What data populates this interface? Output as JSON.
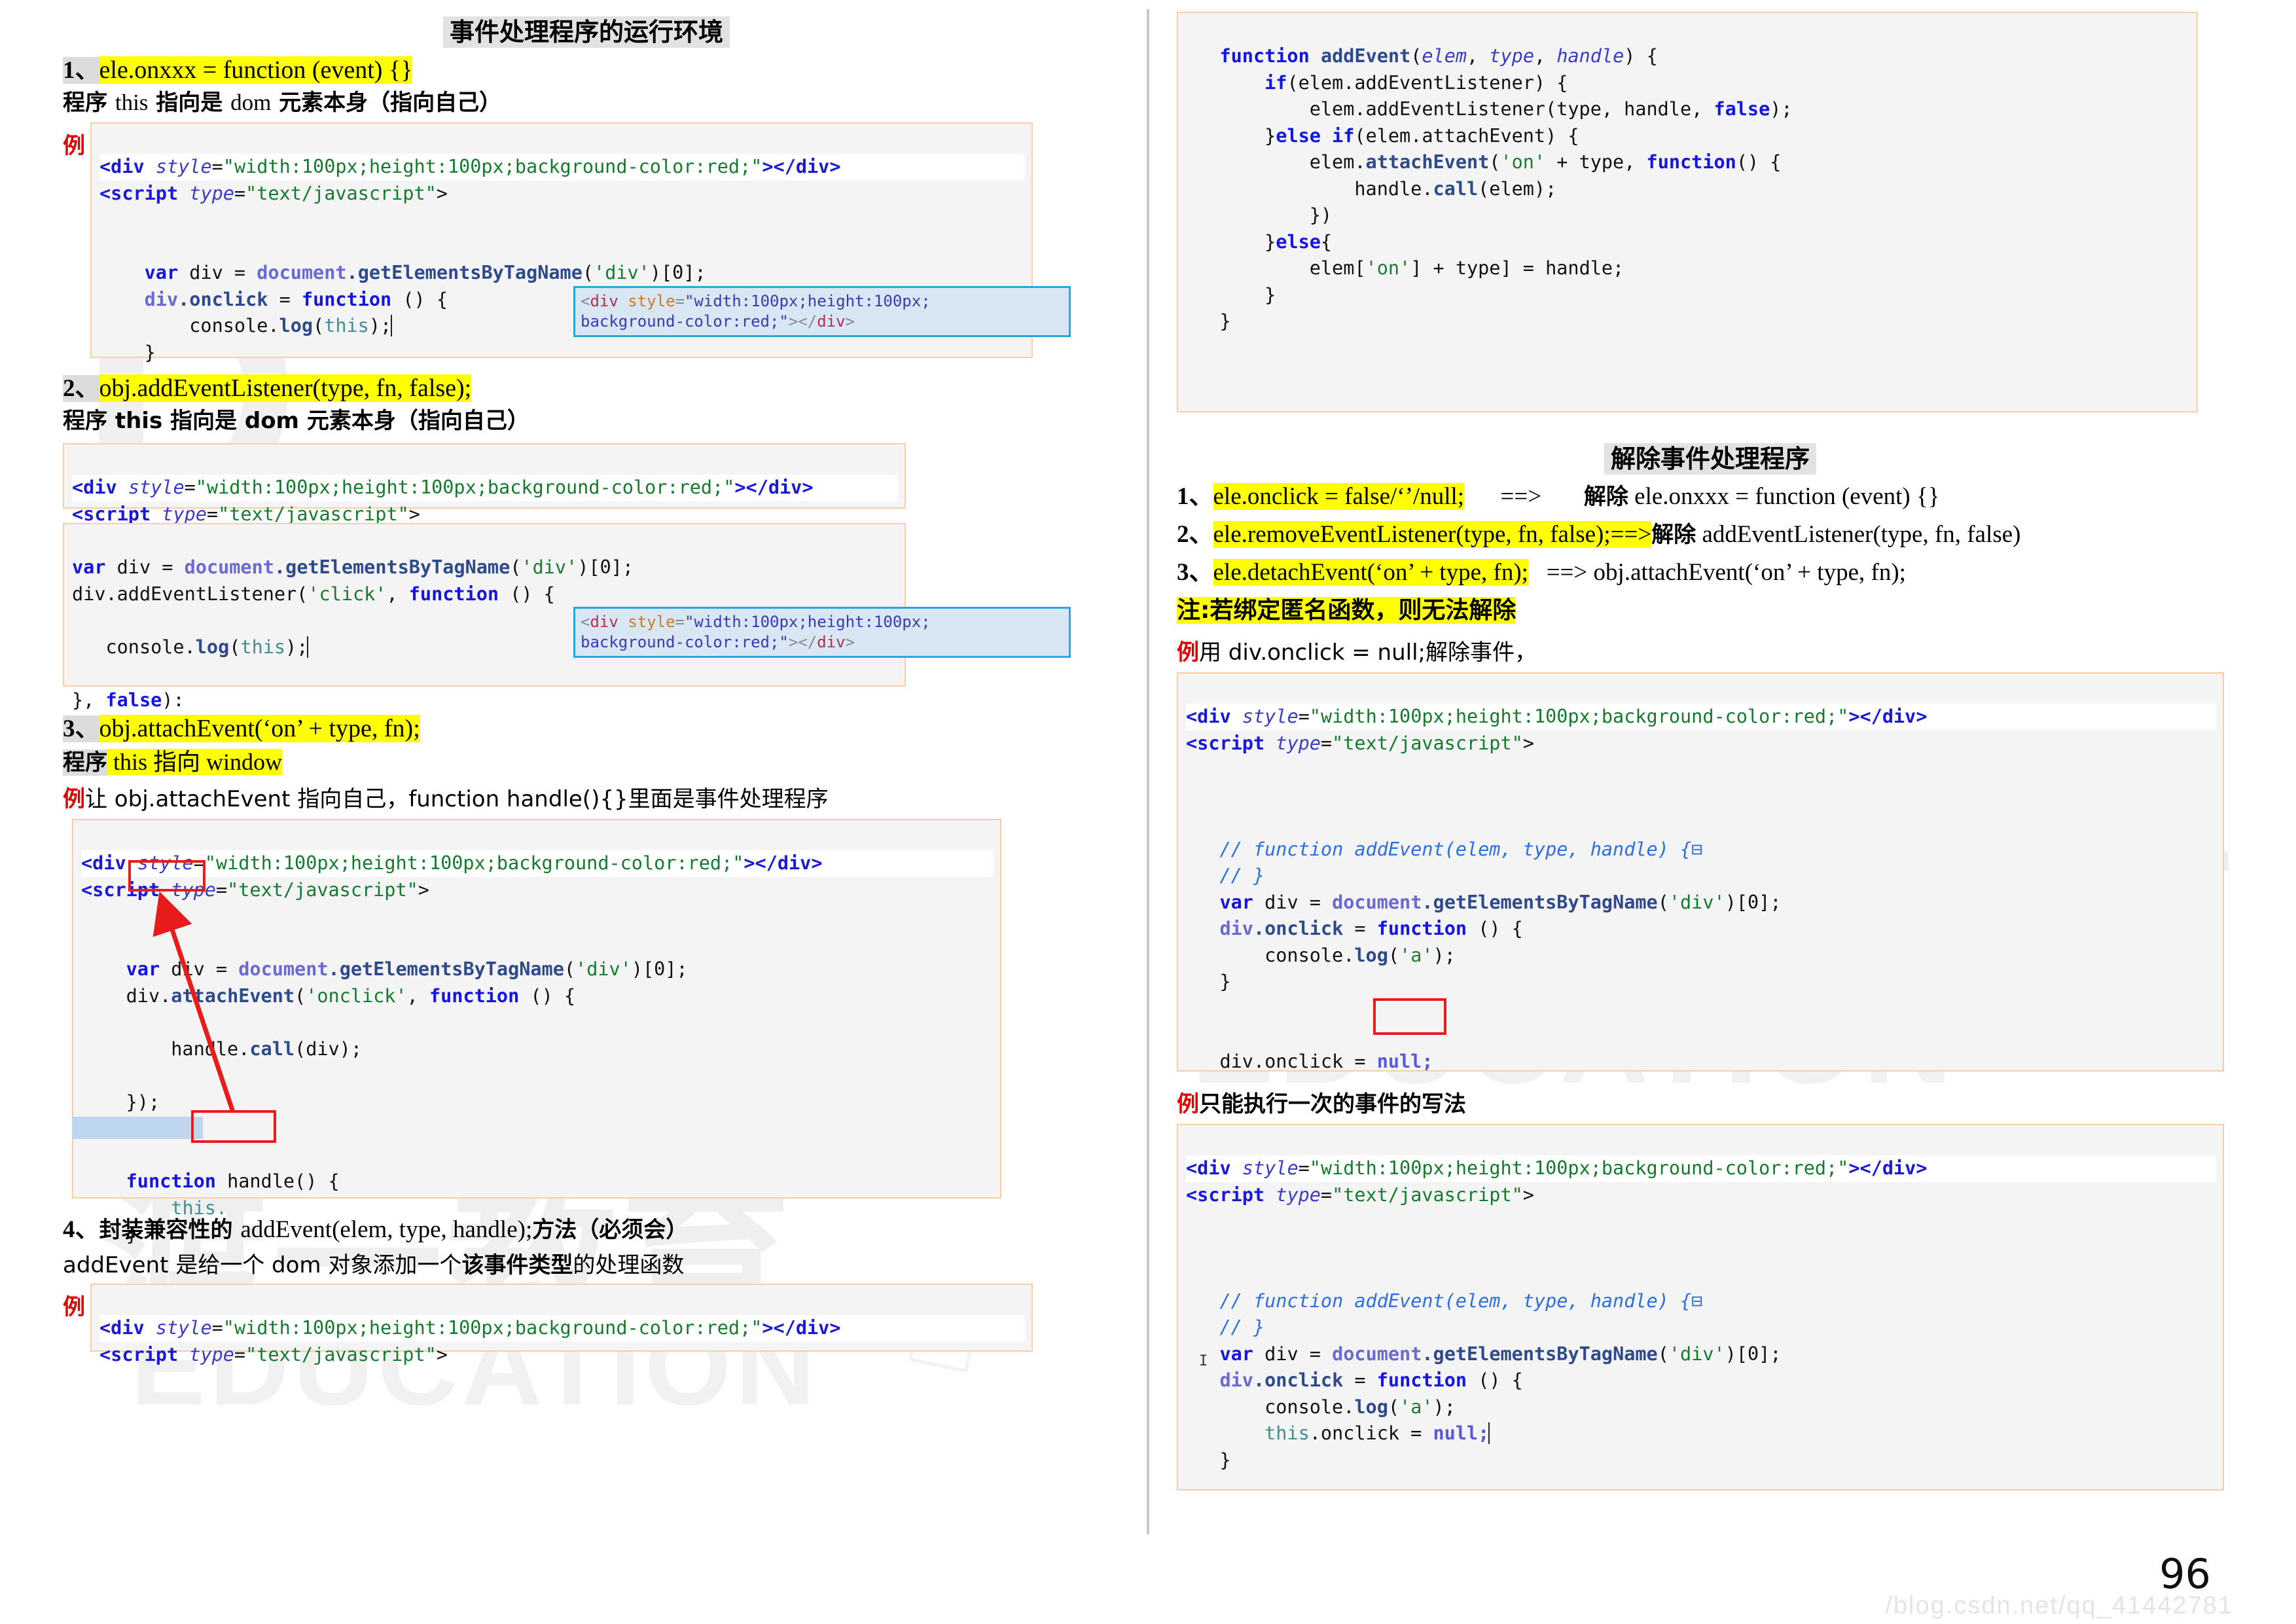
{
  "page": {
    "number": "96",
    "watermarks": {
      "brand_letter": "D",
      "brand_cn_1": "渡一教",
      "brand_cn_2": "渡一教育",
      "brand_edu": "EDUCATION",
      "url": "/blog.csdn.net/qq_41442781"
    },
    "colors": {
      "highlight_yellow": "#ffff00",
      "highlight_gray": "#dcdcdc",
      "code_border": "#f6cfa8",
      "code_bg": "#f4f4f4",
      "annotation_red": "#e81c1c",
      "console_border": "#28a8e0",
      "console_bg": "#d9e7f5",
      "example_red": "#e00000"
    }
  },
  "left": {
    "title": "事件处理程序的运行环境",
    "item1": {
      "number": "1、",
      "signature": "ele.onxxx = function (event) {}",
      "this_note_a": "程序 ",
      "this_note_b": "this",
      "this_note_c": " 指向是 ",
      "this_note_d": "dom",
      "this_note_e": " 元素本身（指向自己）",
      "example_label": "例",
      "code_line1_tag_open": "<div ",
      "code_line1_attr": "style",
      "code_line1_eq": "=",
      "code_line1_val": "\"width:100px;height:100px;background-color:red;\"",
      "code_line1_close": "></div>",
      "code_line2_tag": "<script ",
      "code_line2_attr": "type",
      "code_line2_val": "\"text/javascript\"",
      "code_line2_gt": ">",
      "code_line3": "",
      "code_line4": "",
      "code_var": "var",
      "code_div": " div = ",
      "code_doc": "document",
      "code_getel": ".getElementsByTagName(",
      "code_divstr": "'div'",
      "code_idx": ")[0];",
      "code_onclick_obj": "div",
      "code_onclick_prop": ".onclick",
      "code_onclick_eq": " = ",
      "code_onclick_fn": "function",
      "code_onclick_rest": " () {",
      "code_log": "    console.",
      "code_logfn": "log",
      "code_logthis": "(",
      "code_this": "this",
      "code_logend": ");",
      "code_brace": "}",
      "console_pop_line1": "<div style=\"width:100px;height:100px;",
      "console_pop_line2": "background-color:red;\"></div>"
    },
    "item2": {
      "number": "2、",
      "signature": "obj.addEventListener(type, fn, false);",
      "this_note": "程序 this 指向是 dom 元素本身（指向自己）",
      "code_block_a_l1": "<div style=\"width:100px;height:100px;background-color:red;\"></div>",
      "code_block_a_l2": "<script type=\"text/javascript\">",
      "code_block_b_l1": "var div = document.getElementsByTagName('div')[0];",
      "code_block_b_l2": "div.addEventListener('click', function () {",
      "code_block_b_l3": "    console.log(this);",
      "code_block_b_l4": "}, false);",
      "console_pop_line1": "<div style=\"width:100px;height:100px;",
      "console_pop_line2": "background-color:red;\"></div>"
    },
    "item3": {
      "number": "3、",
      "signature": "obj.attachEvent(‘on’ + type, fn);",
      "this_note_gray": "程序",
      "this_note_yellow": " this 指向 window",
      "example_label": "例",
      "example_text": "让 obj.attachEvent 指向自己，function handle(){}里面是事件处理程序",
      "code_l1": "<div style=\"width:100px;height:100px;background-color:red;\"></div>",
      "code_l2": "<script type=\"text/javascript\">",
      "code_l3": "    var div = document.getElementsByTagName('div')[0];",
      "code_l4": "    div.attachEvent('onclick', function () {",
      "code_l5": "        handle.call(div);",
      "code_l6": "    });",
      "code_l7": "    function handle() {",
      "code_l8": "        this.",
      "code_l9": "    }",
      "annotation": "div. → this."
    },
    "item4": {
      "number": "4、",
      "title_bold": "封装兼容性的 ",
      "title_rest": "addEvent(elem, type, handle);",
      "title_tail": "方法（必须会）",
      "desc_a": "addEvent 是给一个 dom 对象添加一个",
      "desc_b": "该事件类型",
      "desc_c": "的处理函数",
      "example_label": "例",
      "code_l1": "<div style=\"width:100px;height:100px;background-color:red;\"></div>",
      "code_l2": "<script type=\"text/javascript\">"
    }
  },
  "right": {
    "top_code": {
      "l1": "function addEvent(elem, type, handle) {",
      "l2": "    if(elem.addEventListener) {",
      "l3": "        elem.addEventListener(type, handle, false);",
      "l4": "    }else if(elem.attachEvent) {",
      "l5": "        elem.attachEvent('on' + type, function() {",
      "l6": "            handle.call(elem);",
      "l7": "        })",
      "l8": "    }else{",
      "l9": "        elem['on' + type] = handle;",
      "l10": "    }",
      "l11": "}"
    },
    "title": "解除事件处理程序",
    "rules": [
      {
        "number": "1、",
        "left_hl": "ele.onclick = false/‘’/null;",
        "arrow": "==>",
        "right_bold": "解除",
        "right_rest": " ele.onxxx = function (event) {}"
      },
      {
        "number": "2、",
        "left_hl": "ele.removeEventListener(type, fn, false);",
        "arrow": "==>",
        "right_bold": "解除",
        "right_rest": " addEventListener(type, fn, false)"
      },
      {
        "number": "3、",
        "left_hl": "ele.detachEvent(‘on’ + type, fn);",
        "arrow": "==>",
        "right_bold": "",
        "right_rest": " obj.attachEvent(‘on’ + type, fn);"
      }
    ],
    "note": "注:若绑定匿名函数，则无法解除",
    "example1": {
      "label": "例",
      "text": "用 div.onclick = null;解除事件，",
      "code_l1": "<div style=\"width:100px;height:100px;background-color:red;\"></div>",
      "code_l2": "<script type=\"text/javascript\">",
      "code_l3": "    // function addEvent(elem, type, handle) {",
      "code_l4": "    // }",
      "code_l5": "    var div = document.getElementsByTagName('div')[0];",
      "code_l6": "    div.onclick = function () {",
      "code_l7": "        console.log('a');",
      "code_l8": "    }",
      "code_l9": "    div.onclick = null;",
      "highlight_token": "null"
    },
    "example2": {
      "label": "例",
      "text": "只能执行一次的事件的写法",
      "code_l1": "<div style=\"width:100px;height:100px;background-color:red;\"></div>",
      "code_l2": "<script type=\"text/javascript\">",
      "code_l3": "    // function addEvent(elem, type, handle) {",
      "code_l4": "    // }",
      "code_l5": "    var div = document.getElementsByTagName('div')[0];",
      "code_l6": "    div.onclick = function () {",
      "code_l7": "        console.log('a');",
      "code_l8": "        this.onclick = null;",
      "code_l9": "    }"
    }
  }
}
